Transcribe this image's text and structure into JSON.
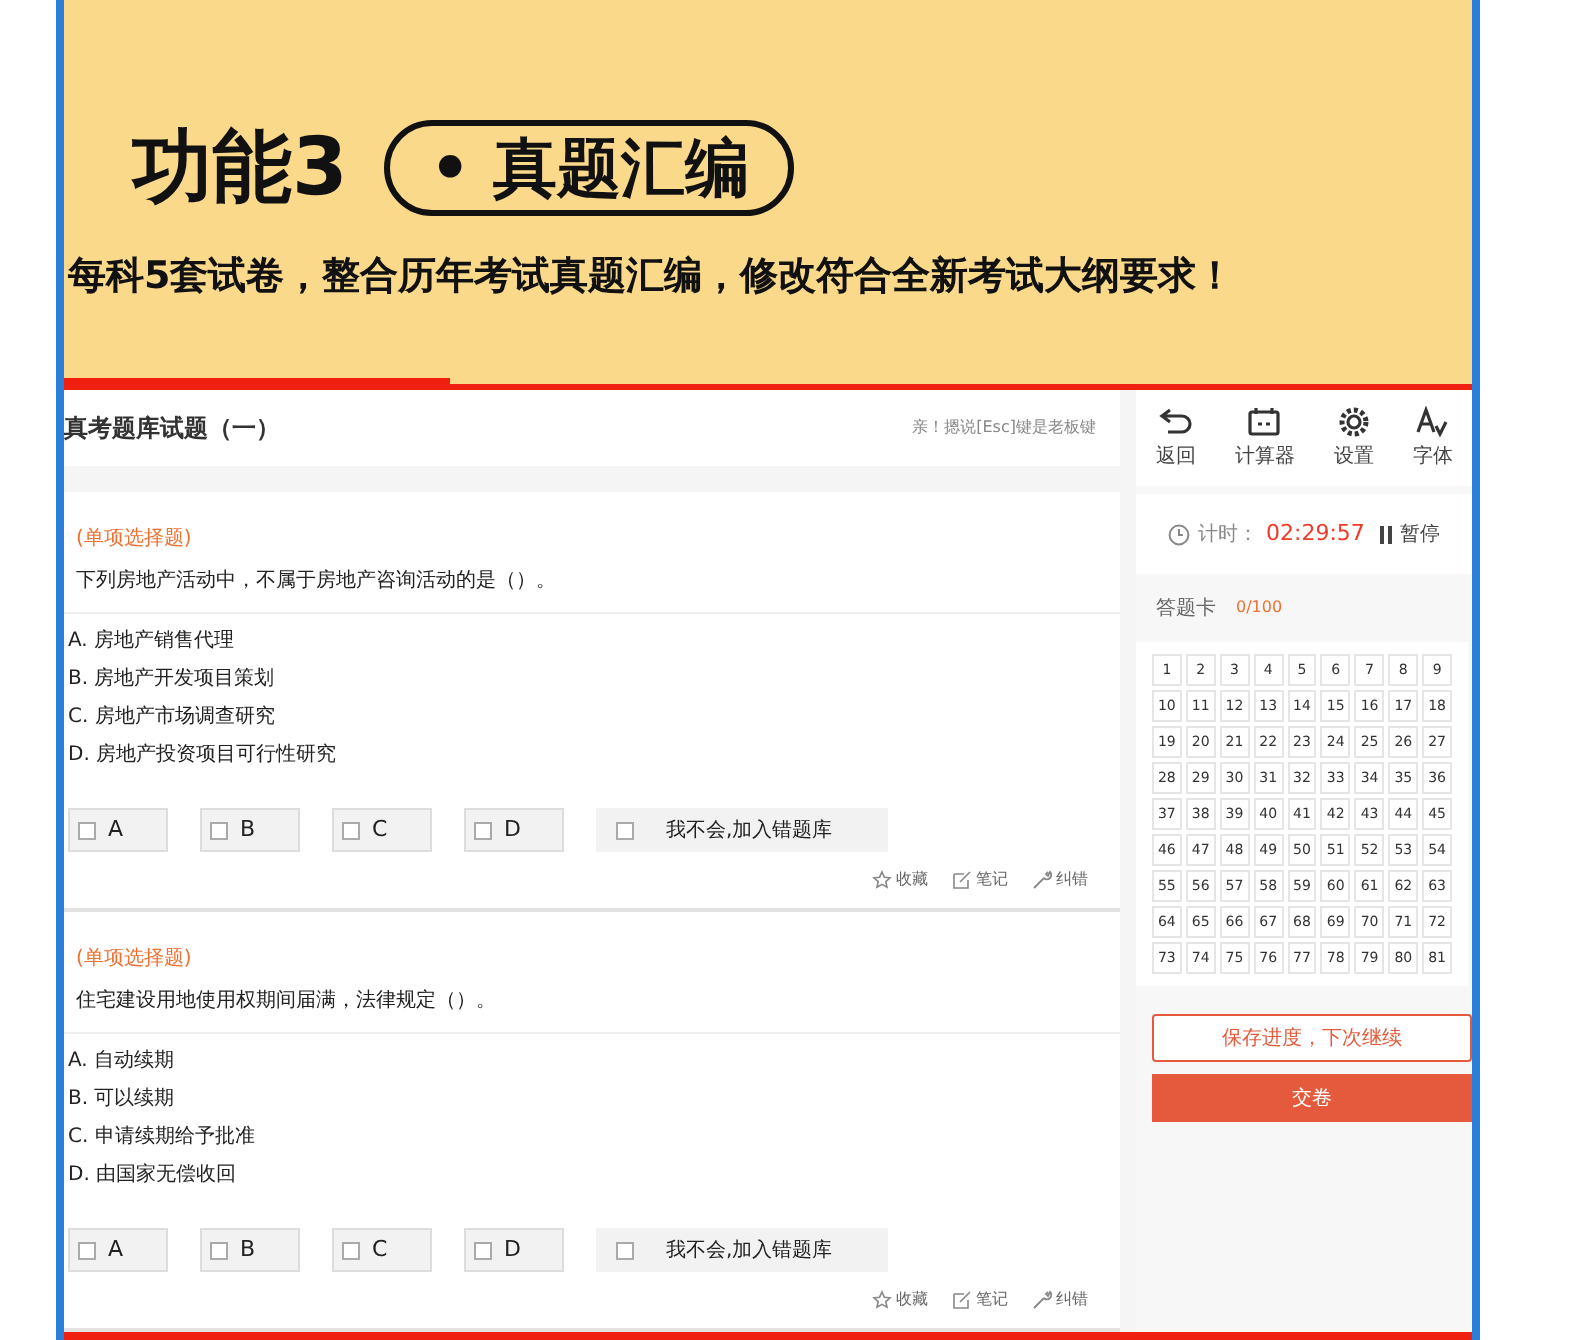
{
  "banner": {
    "heading": "功能3",
    "pill": "• 真题汇编",
    "subtitle": "每科5套试卷，整合历年考试真题汇编，修改符合全新考试大纲要求！"
  },
  "exam": {
    "title": "真考题库试题（一）",
    "hint": "亲！摁说[Esc]键是老板键"
  },
  "questions": [
    {
      "type": "(单项选择题)",
      "text": "下列房地产活动中，不属于房地产咨询活动的是（）。",
      "options": [
        "A. 房地产销售代理",
        "B. 房地产开发项目策划",
        "C. 房地产市场调查研究",
        "D. 房地产投资项目可行性研究"
      ],
      "answers": [
        {
          "label": "A",
          "checked": false
        },
        {
          "label": "B",
          "checked": false
        },
        {
          "label": "C",
          "checked": false
        },
        {
          "label": "D",
          "checked": false
        }
      ],
      "unknown": {
        "label": "我不会,加入错题库",
        "checked": false
      },
      "actions": [
        "收藏",
        "笔记",
        "纠错"
      ]
    },
    {
      "type": "(单项选择题)",
      "text": "住宅建设用地使用权期间届满，法律规定（）。",
      "options": [
        "A. 自动续期",
        "B. 可以续期",
        "C. 申请续期给予批准",
        "D. 由国家无偿收回"
      ],
      "answers": [
        {
          "label": "A",
          "checked": false
        },
        {
          "label": "B",
          "checked": false
        },
        {
          "label": "C",
          "checked": false
        },
        {
          "label": "D",
          "checked": false
        }
      ],
      "unknown": {
        "label": "我不会,加入错题库",
        "checked": false
      },
      "actions": [
        "收藏",
        "笔记",
        "纠错"
      ]
    }
  ],
  "toolbar": [
    {
      "kind": "back",
      "label": "返回"
    },
    {
      "kind": "calculator",
      "label": "计算器"
    },
    {
      "kind": "settings",
      "label": "设置"
    },
    {
      "kind": "font",
      "label": "字体"
    }
  ],
  "timer": {
    "label": "计时：",
    "value": "02:29:57",
    "pause": "暂停"
  },
  "answer_card": {
    "title": "答题卡",
    "count": "0/100",
    "numbers": [
      "1",
      "2",
      "3",
      "4",
      "5",
      "6",
      "7",
      "8",
      "9",
      "10",
      "11",
      "12",
      "13",
      "14",
      "15",
      "16",
      "17",
      "18",
      "19",
      "20",
      "21",
      "22",
      "23",
      "24",
      "25",
      "26",
      "27",
      "28",
      "29",
      "30",
      "31",
      "32",
      "33",
      "34",
      "35",
      "36",
      "37",
      "38",
      "39",
      "40",
      "41",
      "42",
      "43",
      "44",
      "45",
      "46",
      "47",
      "48",
      "49",
      "50",
      "51",
      "52",
      "53",
      "54",
      "55",
      "56",
      "57",
      "58",
      "59",
      "60",
      "61",
      "62",
      "63",
      "64",
      "65",
      "66",
      "67",
      "68",
      "69",
      "70",
      "71",
      "72",
      "73",
      "74",
      "75",
      "76",
      "77",
      "78",
      "79",
      "80",
      "81"
    ]
  },
  "save_button": "保存进度，下次继续",
  "submit_button": "交卷"
}
